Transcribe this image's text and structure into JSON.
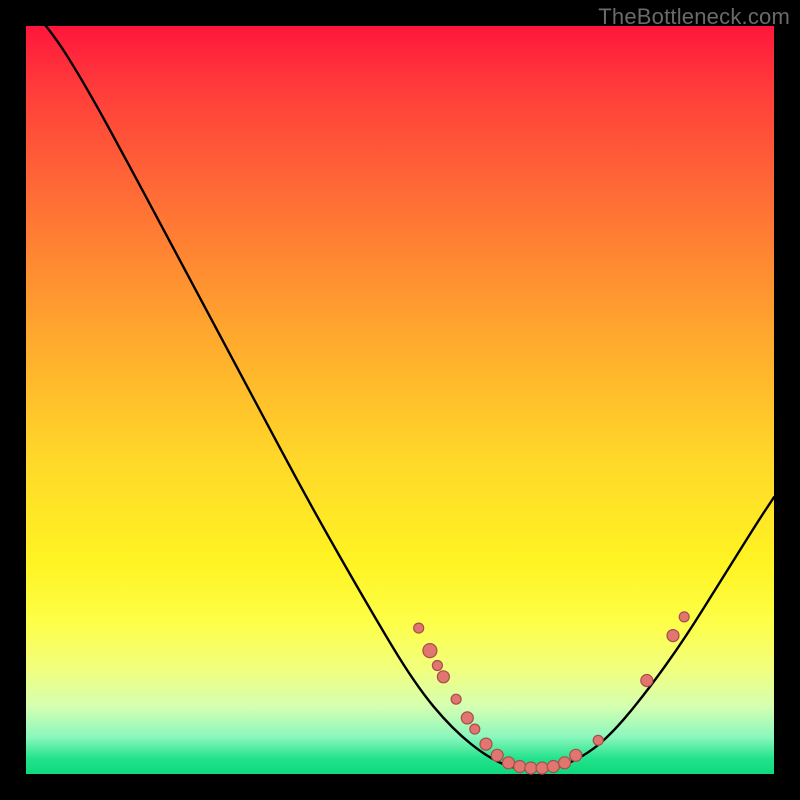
{
  "watermark": "TheBottleneck.com",
  "colors": {
    "dot_fill": "#e0766f",
    "dot_stroke": "#a84e4a",
    "curve": "#000000"
  },
  "chart_data": {
    "type": "line",
    "title": "",
    "xlabel": "",
    "ylabel": "",
    "xlim": [
      0,
      100
    ],
    "ylim": [
      0,
      100
    ],
    "curve": [
      {
        "x": 0,
        "y": 103
      },
      {
        "x": 3,
        "y": 100
      },
      {
        "x": 8,
        "y": 92
      },
      {
        "x": 14,
        "y": 81
      },
      {
        "x": 22,
        "y": 66
      },
      {
        "x": 30,
        "y": 51
      },
      {
        "x": 38,
        "y": 36
      },
      {
        "x": 46,
        "y": 22
      },
      {
        "x": 52,
        "y": 12
      },
      {
        "x": 57,
        "y": 6
      },
      {
        "x": 62,
        "y": 2
      },
      {
        "x": 66,
        "y": 0.5
      },
      {
        "x": 70,
        "y": 0.5
      },
      {
        "x": 74,
        "y": 2
      },
      {
        "x": 78,
        "y": 5
      },
      {
        "x": 83,
        "y": 11
      },
      {
        "x": 88,
        "y": 18
      },
      {
        "x": 93,
        "y": 26
      },
      {
        "x": 98,
        "y": 34
      },
      {
        "x": 100,
        "y": 37
      }
    ],
    "points": [
      {
        "x": 52.5,
        "y": 19.5,
        "r": 5
      },
      {
        "x": 54.0,
        "y": 16.5,
        "r": 7
      },
      {
        "x": 55.0,
        "y": 14.5,
        "r": 5
      },
      {
        "x": 55.8,
        "y": 13.0,
        "r": 6
      },
      {
        "x": 57.5,
        "y": 10.0,
        "r": 5
      },
      {
        "x": 59.0,
        "y": 7.5,
        "r": 6
      },
      {
        "x": 60.0,
        "y": 6.0,
        "r": 5
      },
      {
        "x": 61.5,
        "y": 4.0,
        "r": 6
      },
      {
        "x": 63.0,
        "y": 2.5,
        "r": 6
      },
      {
        "x": 64.5,
        "y": 1.5,
        "r": 6
      },
      {
        "x": 66.0,
        "y": 1.0,
        "r": 6
      },
      {
        "x": 67.5,
        "y": 0.8,
        "r": 6
      },
      {
        "x": 69.0,
        "y": 0.8,
        "r": 6
      },
      {
        "x": 70.5,
        "y": 1.0,
        "r": 6
      },
      {
        "x": 72.0,
        "y": 1.5,
        "r": 6
      },
      {
        "x": 73.5,
        "y": 2.5,
        "r": 6
      },
      {
        "x": 76.5,
        "y": 4.5,
        "r": 5
      },
      {
        "x": 83.0,
        "y": 12.5,
        "r": 6
      },
      {
        "x": 86.5,
        "y": 18.5,
        "r": 6
      },
      {
        "x": 88.0,
        "y": 21.0,
        "r": 5
      }
    ]
  }
}
